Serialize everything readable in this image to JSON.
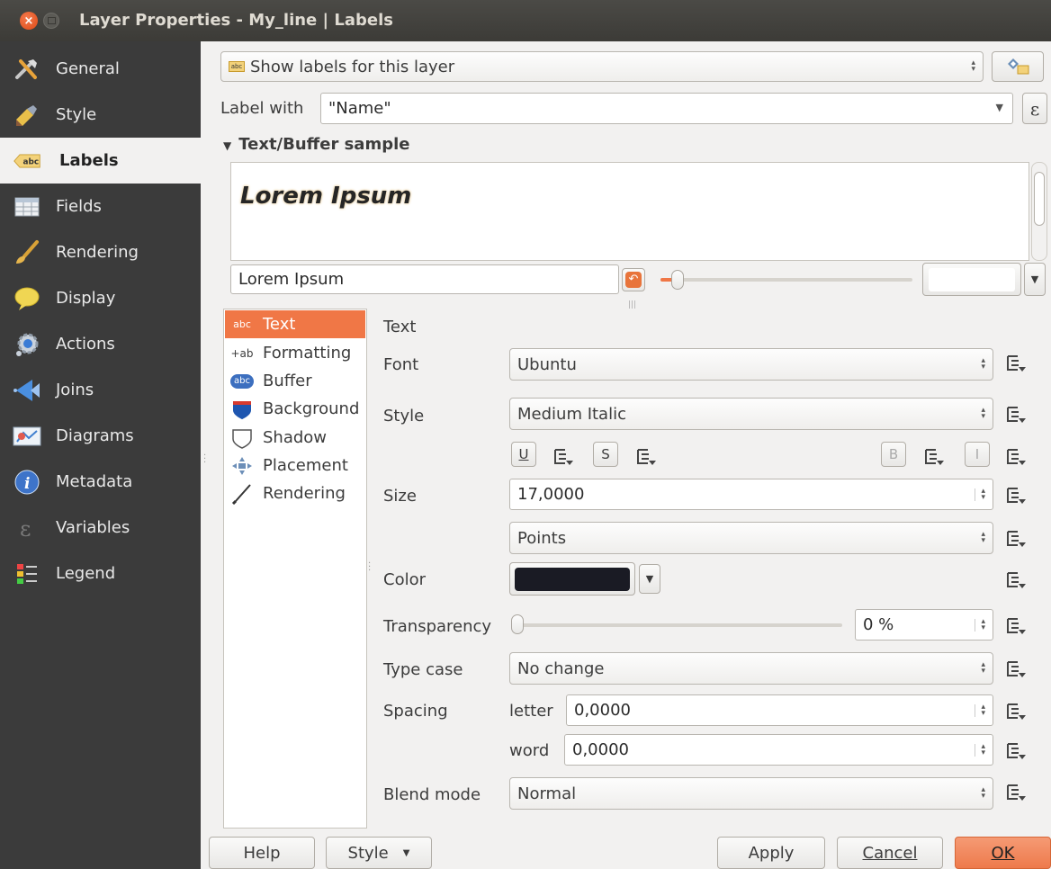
{
  "window": {
    "title": "Layer Properties - My_line | Labels",
    "close_glyph": "×"
  },
  "sidebar": {
    "items": [
      {
        "label": "General",
        "icon": "tools-icon"
      },
      {
        "label": "Style",
        "icon": "paintbrush-icon"
      },
      {
        "label": "Labels",
        "icon": "abc-label-icon"
      },
      {
        "label": "Fields",
        "icon": "table-icon"
      },
      {
        "label": "Rendering",
        "icon": "brush-icon"
      },
      {
        "label": "Display",
        "icon": "speech-bubble-icon"
      },
      {
        "label": "Actions",
        "icon": "gear-icon"
      },
      {
        "label": "Joins",
        "icon": "join-arrow-icon"
      },
      {
        "label": "Diagrams",
        "icon": "diagram-icon"
      },
      {
        "label": "Metadata",
        "icon": "info-icon"
      },
      {
        "label": "Variables",
        "icon": "epsilon-icon"
      },
      {
        "label": "Legend",
        "icon": "legend-icon"
      }
    ],
    "active": "Labels"
  },
  "header": {
    "mode": "Show labels for this layer",
    "label_with_label": "Label with",
    "label_with_value": "\"Name\"",
    "expression_glyph": "ε"
  },
  "sample": {
    "section_title": "Text/Buffer sample",
    "preview_text": "Lorem Ipsum",
    "input_value": "Lorem Ipsum",
    "grip": "|||"
  },
  "tabs": [
    {
      "label": "Text",
      "icon": "abc"
    },
    {
      "label": "Formatting",
      "icon": "+ab"
    },
    {
      "label": "Buffer",
      "icon": "abc"
    },
    {
      "label": "Background",
      "icon": "shield-icon"
    },
    {
      "label": "Shadow",
      "icon": "shadow-icon"
    },
    {
      "label": "Placement",
      "icon": "placement-icon"
    },
    {
      "label": "Rendering",
      "icon": "brush-icon"
    }
  ],
  "text_panel": {
    "heading": "Text",
    "font_label": "Font",
    "font_value": "Ubuntu",
    "style_label": "Style",
    "style_value": "Medium Italic",
    "underline": "U",
    "strike": "S",
    "bold": "B",
    "italic": "I",
    "size_label": "Size",
    "size_value": "17,0000",
    "size_unit": "Points",
    "color_label": "Color",
    "color_value": "#1a1b24",
    "transparency_label": "Transparency",
    "transparency_value": "0 %",
    "transparency_fraction": 0,
    "typecase_label": "Type case",
    "typecase_value": "No change",
    "spacing_label": "Spacing",
    "letter_label": "letter",
    "letter_value": "0,0000",
    "word_label": "word",
    "word_value": "0,0000",
    "blend_label": "Blend mode",
    "blend_value": "Normal"
  },
  "footer": {
    "help": "Help",
    "style": "Style",
    "apply": "Apply",
    "cancel": "Cancel",
    "ok": "OK"
  },
  "colors": {
    "accent": "#f07746",
    "sidebar_bg": "#3b3b3b",
    "titlebar_bg": "#3c3b37"
  }
}
